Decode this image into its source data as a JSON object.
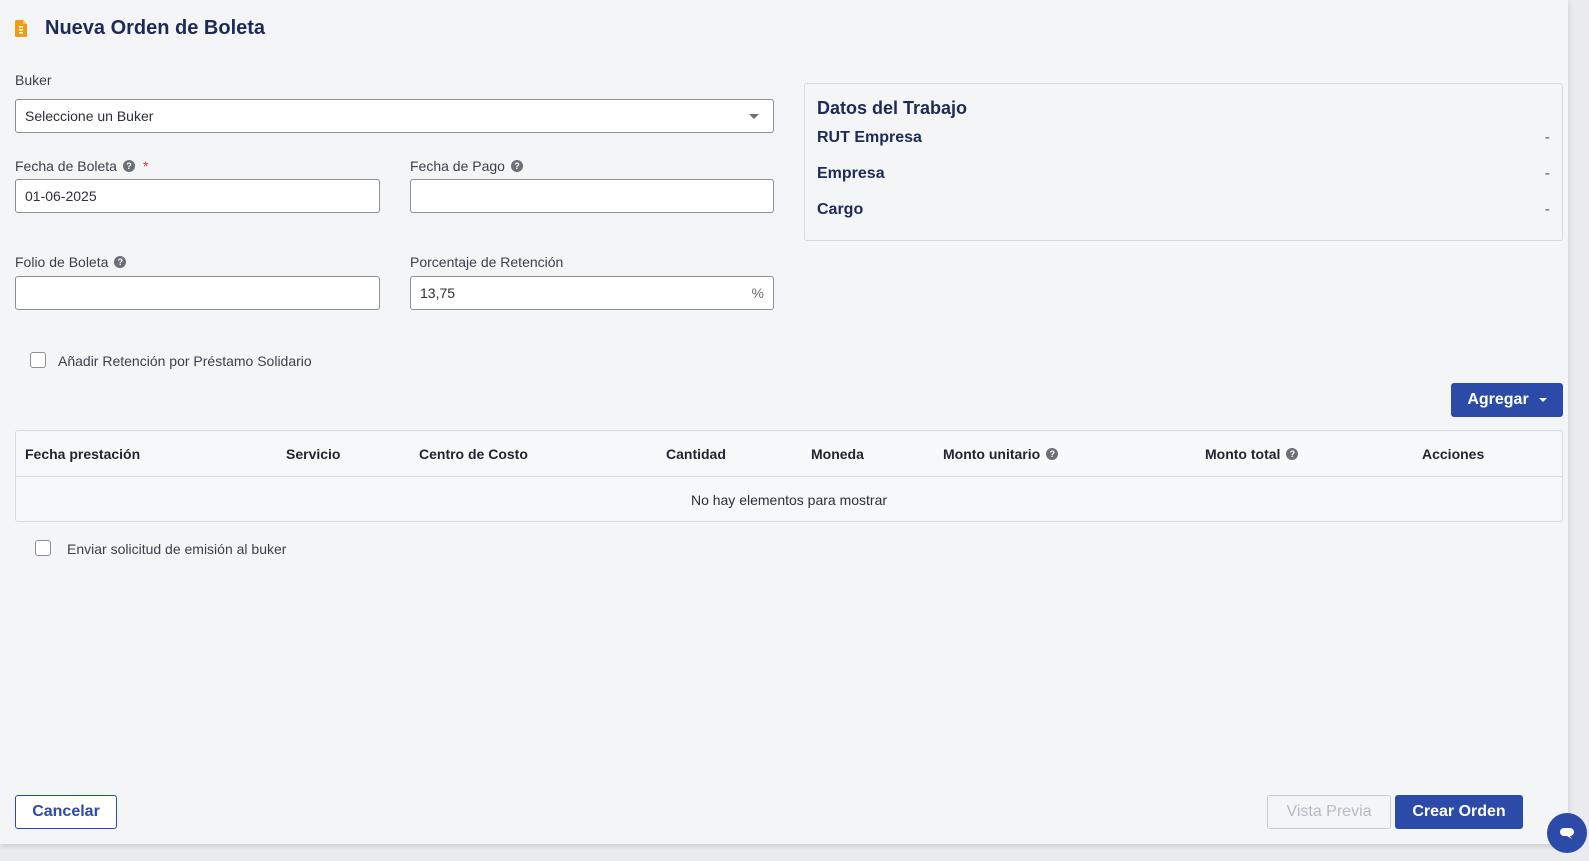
{
  "header": {
    "title": "Nueva Orden de Boleta",
    "icon": "document-icon",
    "icon_color": "#f39c12"
  },
  "form": {
    "buker": {
      "label": "Buker",
      "placeholder": "Seleccione un Buker"
    },
    "fecha_boleta": {
      "label": "Fecha de Boleta",
      "required_mark": "*",
      "value": "01-06-2025"
    },
    "fecha_pago": {
      "label": "Fecha de Pago",
      "value": ""
    },
    "folio_boleta": {
      "label": "Folio de Boleta",
      "value": ""
    },
    "porcentaje": {
      "label": "Porcentaje de Retención",
      "value": "13,75",
      "suffix": "%"
    },
    "prestamo_solidario": {
      "label": "Añadir Retención por Préstamo Solidario",
      "checked": false
    }
  },
  "info_card": {
    "title": "Datos del Trabajo",
    "rows": [
      {
        "label": "RUT Empresa",
        "value": "-"
      },
      {
        "label": "Empresa",
        "value": "-"
      },
      {
        "label": "Cargo",
        "value": "-"
      }
    ]
  },
  "table": {
    "add_button": "Agregar",
    "columns": [
      "Fecha prestación",
      "Servicio",
      "Centro de Costo",
      "Cantidad",
      "Moneda",
      "Monto unitario",
      "Monto total",
      "Acciones"
    ],
    "empty_text": "No hay elementos para mostrar"
  },
  "send_request": {
    "label": "Enviar solicitud de emisión al buker",
    "checked": false
  },
  "footer": {
    "cancel": "Cancelar",
    "preview": "Vista Previa",
    "create": "Crear Orden"
  },
  "colors": {
    "primary": "#2c4aa8",
    "title": "#1d2a56",
    "required": "#d0343a"
  }
}
